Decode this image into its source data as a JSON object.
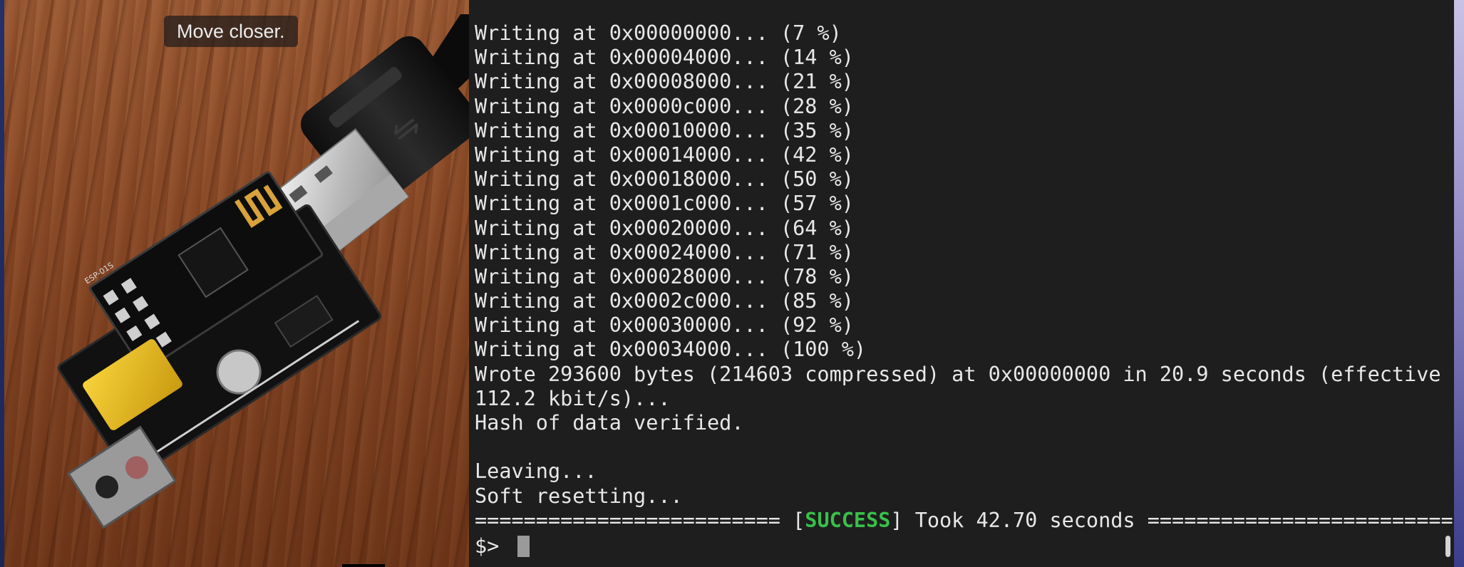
{
  "camera": {
    "tooltip": "Move closer.",
    "board_silkscreen": "ESP-01S",
    "usb_symbol": "usb-icon"
  },
  "terminal": {
    "lines": [
      "Writing at 0x00000000... (7 %)",
      "Writing at 0x00004000... (14 %)",
      "Writing at 0x00008000... (21 %)",
      "Writing at 0x0000c000... (28 %)",
      "Writing at 0x00010000... (35 %)",
      "Writing at 0x00014000... (42 %)",
      "Writing at 0x00018000... (50 %)",
      "Writing at 0x0001c000... (57 %)",
      "Writing at 0x00020000... (64 %)",
      "Writing at 0x00024000... (71 %)",
      "Writing at 0x00028000... (78 %)",
      "Writing at 0x0002c000... (85 %)",
      "Writing at 0x00030000... (92 %)",
      "Writing at 0x00034000... (100 %)",
      "Wrote 293600 bytes (214603 compressed) at 0x00000000 in 20.9 seconds (effective",
      "112.2 kbit/s)...",
      "Hash of data verified.",
      "",
      "Leaving...",
      "Soft resetting..."
    ],
    "summary": {
      "left_rule": "========================= [",
      "status": "SUCCESS",
      "right_text": "] Took 42.70 seconds ========================="
    },
    "prompt": "$>",
    "status_color": "#39c04a"
  }
}
